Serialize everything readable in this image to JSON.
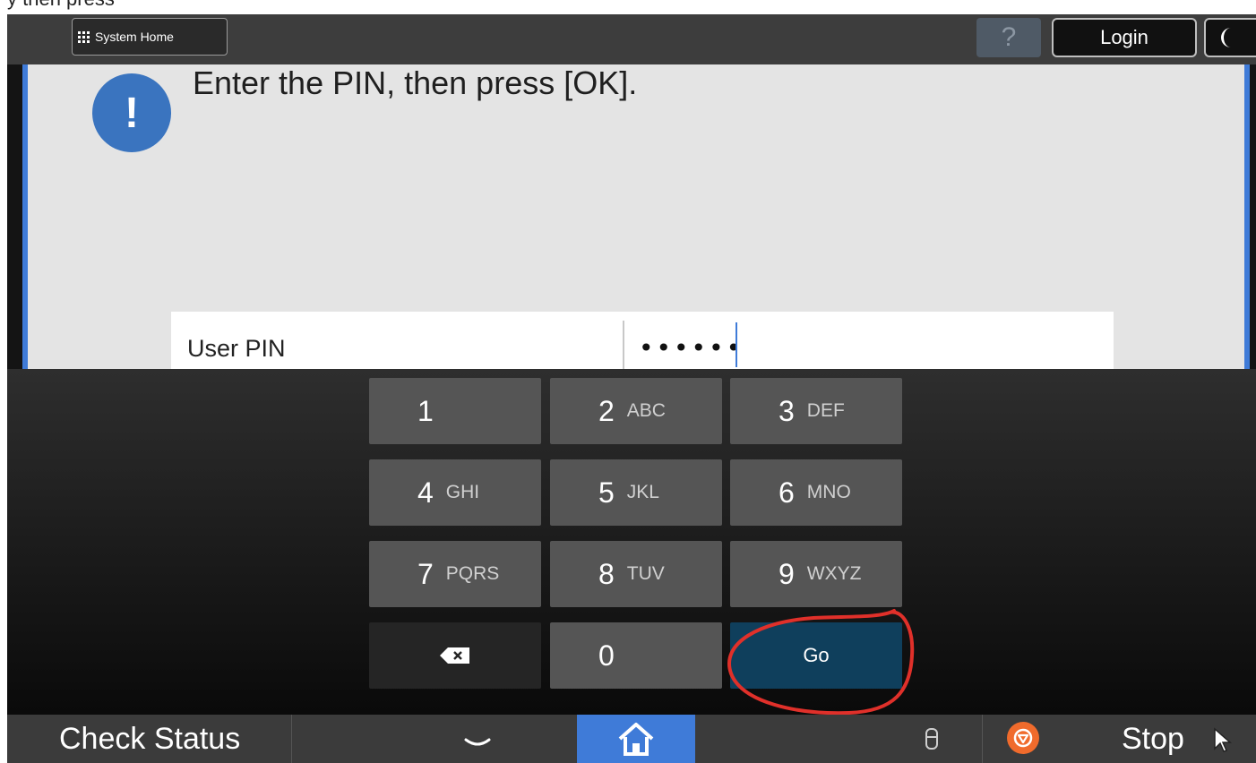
{
  "top_strip": {
    "text": "y then press"
  },
  "header": {
    "system_home_label": "System Home",
    "help_label": "?",
    "login_label": "Login"
  },
  "message": {
    "alert_icon": "!",
    "text": "Enter the PIN, then press [OK]."
  },
  "pin_field": {
    "label": "User PIN",
    "value": "••••••"
  },
  "keypad": {
    "keys": [
      {
        "num": "1",
        "letters": ""
      },
      {
        "num": "2",
        "letters": "ABC"
      },
      {
        "num": "3",
        "letters": "DEF"
      },
      {
        "num": "4",
        "letters": "GHI"
      },
      {
        "num": "5",
        "letters": "JKL"
      },
      {
        "num": "6",
        "letters": "MNO"
      },
      {
        "num": "7",
        "letters": "PQRS"
      },
      {
        "num": "8",
        "letters": "TUV"
      },
      {
        "num": "9",
        "letters": "WXYZ"
      },
      {
        "num": "0",
        "letters": ""
      }
    ],
    "go_label": "Go",
    "backspace_icon": "backspace-icon"
  },
  "footer": {
    "check_status_label": "Check Status",
    "stop_label": "Stop"
  },
  "colors": {
    "accent_blue": "#3f7bd8",
    "go_key": "#0f3f5c",
    "stop_orange": "#f06b2c",
    "annotation_red": "#e0302a"
  }
}
